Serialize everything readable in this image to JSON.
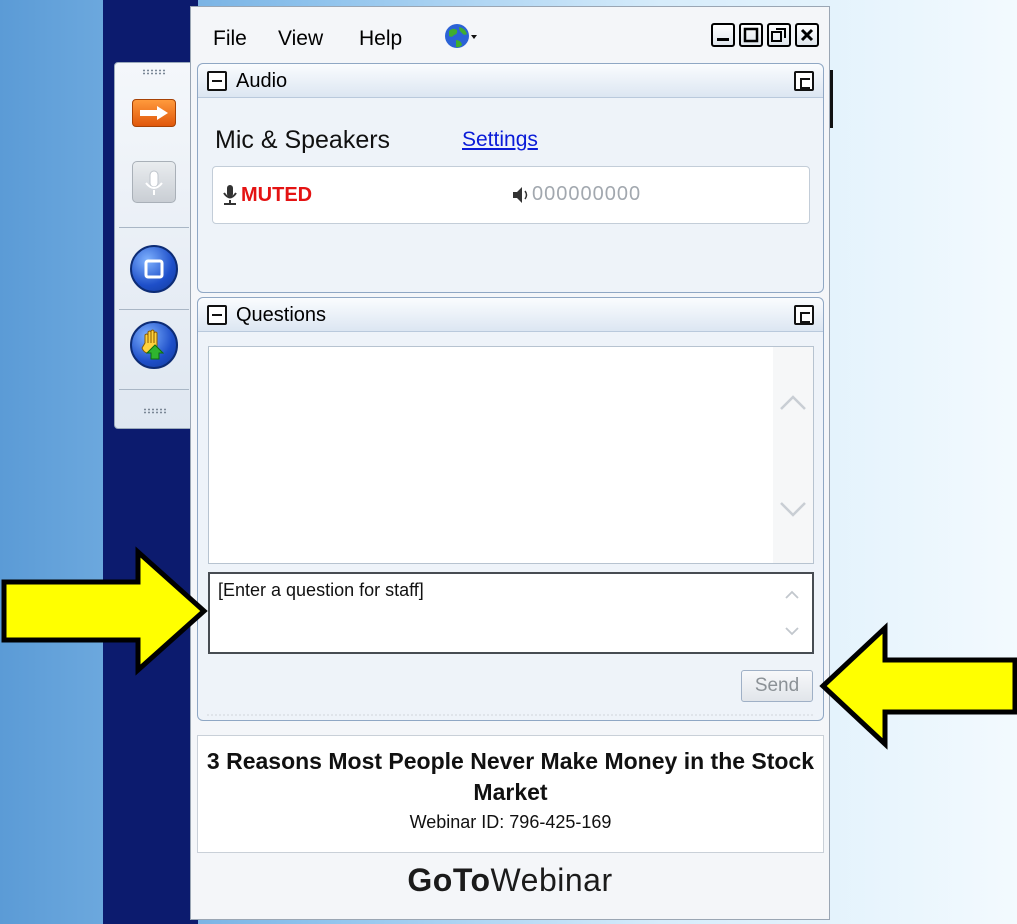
{
  "menu": {
    "file": "File",
    "view": "View",
    "help": "Help"
  },
  "audio": {
    "title": "Audio",
    "mode": "Mic & Speakers",
    "settings_link": "Settings",
    "status": "MUTED",
    "level_text": "000000000"
  },
  "questions": {
    "title": "Questions",
    "input_value": "[Enter a question for staff]",
    "send_label": "Send"
  },
  "webinar": {
    "title": "3 Reasons Most People Never Make Money in the Stock Market",
    "id_text": "Webinar ID: 796-425-169"
  },
  "brand": {
    "bold": "GoTo",
    "light": "Webinar"
  },
  "colors": {
    "muted_red": "#e41313",
    "link_blue": "#0a1bd8",
    "arrow_yellow": "#ffff00",
    "toolbar_orange": "#e0570b"
  },
  "icons": [
    "arrow-right-icon",
    "microphone-icon",
    "screen-icon",
    "raise-hand-icon",
    "globe-icon",
    "minimize-icon",
    "maximize-icon",
    "restore-icon",
    "close-icon",
    "collapse-icon",
    "popout-icon",
    "speaker-icon",
    "scroll-up-icon",
    "scroll-down-icon"
  ]
}
